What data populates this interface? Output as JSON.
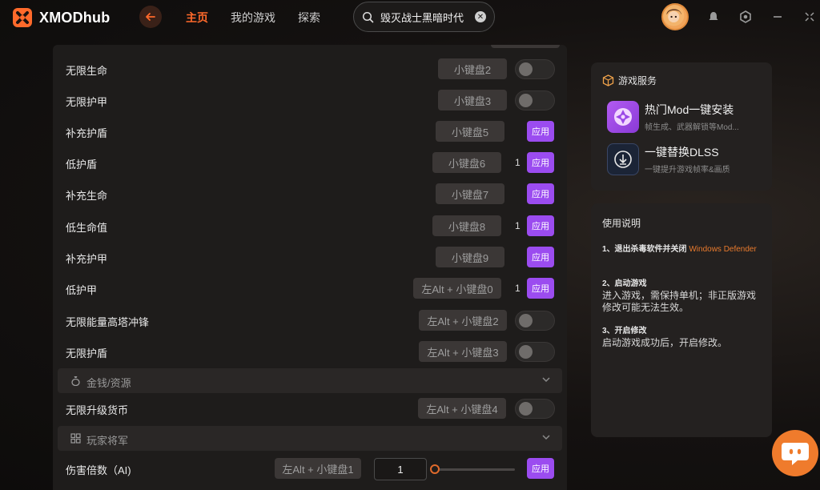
{
  "app": {
    "logo_text": "XMODhub"
  },
  "nav": {
    "home": "主页",
    "my_games": "我的游戏",
    "explore": "探索"
  },
  "search": {
    "value": "毁灭战士黑暗时代"
  },
  "colors": {
    "accent": "#ff6a2b",
    "apply": "#9b4cf0",
    "panel": "#1e1c1b"
  },
  "cheats": [
    {
      "label": "无限生命",
      "key": "小键盘2",
      "control": "toggle",
      "enabled": false
    },
    {
      "label": "无限护甲",
      "key": "小键盘3",
      "control": "toggle",
      "enabled": false
    },
    {
      "label": "补充护盾",
      "key": "小键盘5",
      "control": "apply",
      "apply_label": "应用"
    },
    {
      "label": "低护盾",
      "key": "小键盘6",
      "value": "1",
      "control": "apply",
      "apply_label": "应用"
    },
    {
      "label": "补充生命",
      "key": "小键盘7",
      "control": "apply",
      "apply_label": "应用"
    },
    {
      "label": "低生命值",
      "key": "小键盘8",
      "value": "1",
      "control": "apply",
      "apply_label": "应用"
    },
    {
      "label": "补充护甲",
      "key": "小键盘9",
      "control": "apply",
      "apply_label": "应用"
    },
    {
      "label": "低护甲",
      "key": "左Alt + 小键盘0",
      "value": "1",
      "control": "apply",
      "apply_label": "应用"
    },
    {
      "label": "无限能量高塔冲锋",
      "key": "左Alt + 小键盘2",
      "control": "toggle",
      "enabled": false
    },
    {
      "label": "无限护盾",
      "key": "左Alt + 小键盘3",
      "control": "toggle",
      "enabled": false
    }
  ],
  "sections": {
    "money": {
      "label": "金钱/资源",
      "icon": "money-bag-icon"
    },
    "player": {
      "label": "玩家将军",
      "icon": "grid-icon"
    }
  },
  "money_cheats": [
    {
      "label": "无限升级货币",
      "key": "左Alt + 小键盘4",
      "control": "toggle",
      "enabled": false
    }
  ],
  "player_cheats": [
    {
      "label": "伤害倍数（AI)",
      "key": "左Alt + 小键盘1",
      "value": "1",
      "slider": 0,
      "control": "apply",
      "apply_label": "应用"
    }
  ],
  "services": {
    "title": "游戏服务",
    "items": [
      {
        "name": "热门Mod一键安装",
        "desc": "帧生成、武器解锁等Mod..."
      },
      {
        "name": "一键替换DLSS",
        "desc": "一键提升游戏帧率&画质"
      }
    ]
  },
  "instructions": {
    "title": "使用说明",
    "steps": [
      {
        "title": "1、退出杀毒软件并关闭",
        "title_highlight": "Windows Defender",
        "body": ""
      },
      {
        "title": "2、启动游戏",
        "body": "进入游戏，需保持单机；非正版游戏修改可能无法生效。"
      },
      {
        "title": "3、开启修改",
        "body": "启动游戏成功后，开启修改。"
      }
    ]
  }
}
